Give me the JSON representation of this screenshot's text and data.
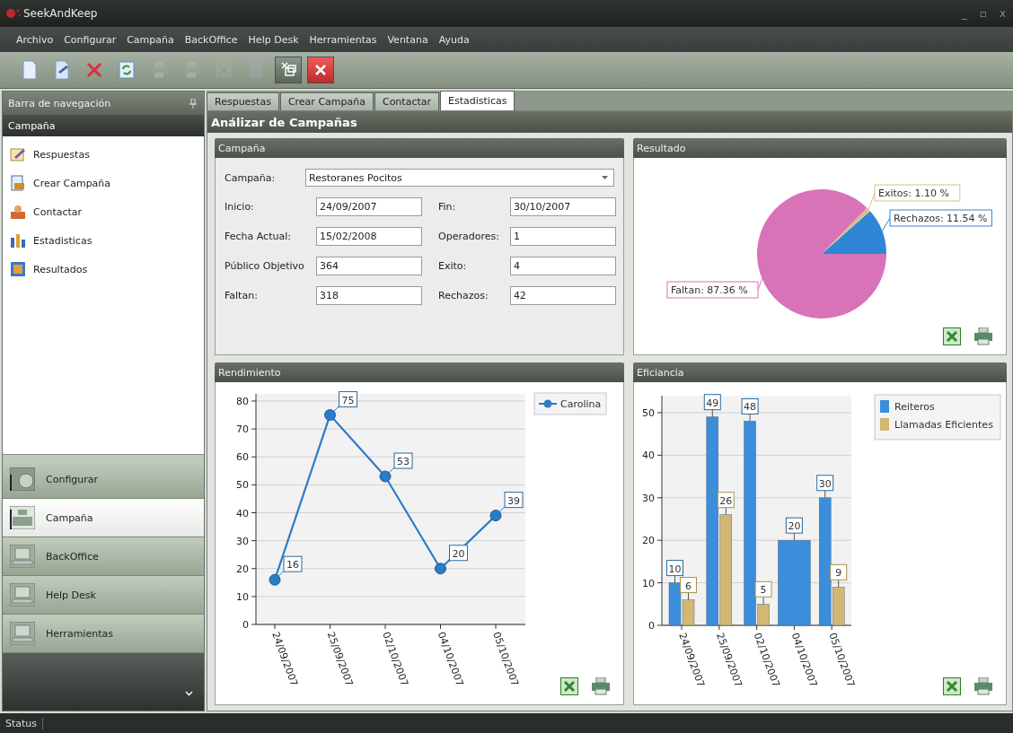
{
  "window": {
    "title": "SeekAndKeep",
    "controls": [
      "_",
      "▫",
      "x"
    ]
  },
  "menu": [
    "Archivo",
    "Configurar",
    "Campaña",
    "BackOffice",
    "Help Desk",
    "Herramientas",
    "Ventana",
    "Ayuda"
  ],
  "toolbar": [
    {
      "kind": "new",
      "disabled": false
    },
    {
      "kind": "edit",
      "disabled": false
    },
    {
      "kind": "delete",
      "disabled": false
    },
    {
      "kind": "refresh",
      "disabled": false
    },
    {
      "kind": "print",
      "disabled": true
    },
    {
      "kind": "print",
      "disabled": true
    },
    {
      "kind": "excel",
      "disabled": true
    },
    {
      "kind": "doc",
      "disabled": true
    },
    {
      "kind": "restore",
      "disabled": false
    },
    {
      "kind": "close",
      "disabled": false
    }
  ],
  "sidebar": {
    "title": "Barra de navegación",
    "group": "Campaña",
    "items": [
      {
        "label": "Respuestas",
        "kind": "edit"
      },
      {
        "label": "Crear Campaña",
        "kind": "create"
      },
      {
        "label": "Contactar",
        "kind": "contact"
      },
      {
        "label": "Estadisticas",
        "kind": "stats"
      },
      {
        "label": "Resultados",
        "kind": "results"
      }
    ],
    "nav_buttons": [
      {
        "label": "Configurar",
        "kind": "gear",
        "selected": false
      },
      {
        "label": "Campaña",
        "kind": "grid",
        "selected": true
      },
      {
        "label": "BackOffice",
        "kind": "monitor",
        "selected": false
      },
      {
        "label": "Help Desk",
        "kind": "monitor",
        "selected": false
      },
      {
        "label": "Herramientas",
        "kind": "monitor",
        "selected": false
      }
    ]
  },
  "tabs": [
    {
      "label": "Respuestas",
      "selected": false
    },
    {
      "label": "Crear Campaña",
      "selected": false
    },
    {
      "label": "Contactar",
      "selected": false
    },
    {
      "label": "Estadisticas",
      "selected": true
    }
  ],
  "page_title": "Análizar de Campañas",
  "campaign_panel": {
    "title": "Campaña",
    "campaign_label": "Campaña:",
    "campaign_value": "Restoranes Pocitos",
    "fields": [
      {
        "label": "Inicio:",
        "value": "24/09/2007"
      },
      {
        "label": "Fin:",
        "value": "30/10/2007"
      },
      {
        "label": "Fecha Actual:",
        "value": "15/02/2008"
      },
      {
        "label": "Operadores:",
        "value": "1"
      },
      {
        "label": "Público Objetivo",
        "value": "364"
      },
      {
        "label": "Exito:",
        "value": "4"
      },
      {
        "label": "Faltan:",
        "value": "318"
      },
      {
        "label": "Rechazos:",
        "value": "42"
      }
    ]
  },
  "result_panel": {
    "title": "Resultado",
    "chart_data": {
      "type": "pie",
      "values": [
        11.54,
        1.1,
        87.36
      ],
      "value_labels": [
        "Rechazos: 11.54 %",
        "Exitos: 1.10 %",
        "Faltan: 87.36 %"
      ]
    }
  },
  "performance_panel": {
    "title": "Rendimiento",
    "chart_data": {
      "type": "line",
      "categories": [
        "24/09/2007",
        "25/09/2007",
        "02/10/2007",
        "04/10/2007",
        "05/10/2007"
      ],
      "series": [
        {
          "name": "Carolina",
          "color": "#2b7bc8",
          "marker": "circle",
          "values": [
            16,
            75,
            53,
            20,
            39
          ]
        }
      ],
      "grid": true,
      "legend": "right",
      "ylim": [
        0,
        80
      ],
      "yticks": [
        0,
        10,
        20,
        30,
        40,
        50,
        60,
        70,
        80
      ],
      "data_labels": true
    }
  },
  "efficiency_panel": {
    "title": "Eficiancia",
    "chart_data": {
      "type": "bar",
      "categories": [
        "24/09/2007",
        "25/09/2007",
        "02/10/2007",
        "04/10/2007",
        "05/10/2007"
      ],
      "series": [
        {
          "name": "Reiteros",
          "color": "#3a8edb",
          "values": [
            10,
            49,
            48,
            20,
            30
          ]
        },
        {
          "name": "Llamadas Eficientes",
          "color": "#d2b873",
          "values": [
            6,
            26,
            5,
            null,
            9
          ]
        }
      ],
      "grid": true,
      "legend": "right",
      "ylim": [
        0,
        54
      ],
      "yticks": [
        0,
        10,
        20,
        30,
        40,
        50
      ],
      "data_labels": true
    }
  },
  "status_bar": "Status"
}
